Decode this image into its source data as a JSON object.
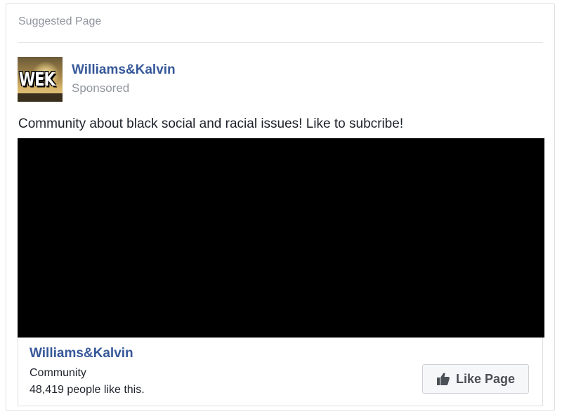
{
  "card": {
    "header_label": "Suggested Page"
  },
  "post": {
    "page_name": "Williams&Kalvin",
    "sponsored_label": "Sponsored",
    "avatar_logo_text": "WEK",
    "text": "Community about black social and racial issues! Like to subcribe!"
  },
  "footer": {
    "page_name": "Williams&Kalvin",
    "category": "Community",
    "likes_text": "48,419 people like this.",
    "like_button_label": "Like Page",
    "like_icon": "thumbs-up-icon"
  },
  "colors": {
    "link_blue": "#365899",
    "muted_gray": "#90949c",
    "text_dark": "#1d2129",
    "media_bg": "#000000"
  }
}
